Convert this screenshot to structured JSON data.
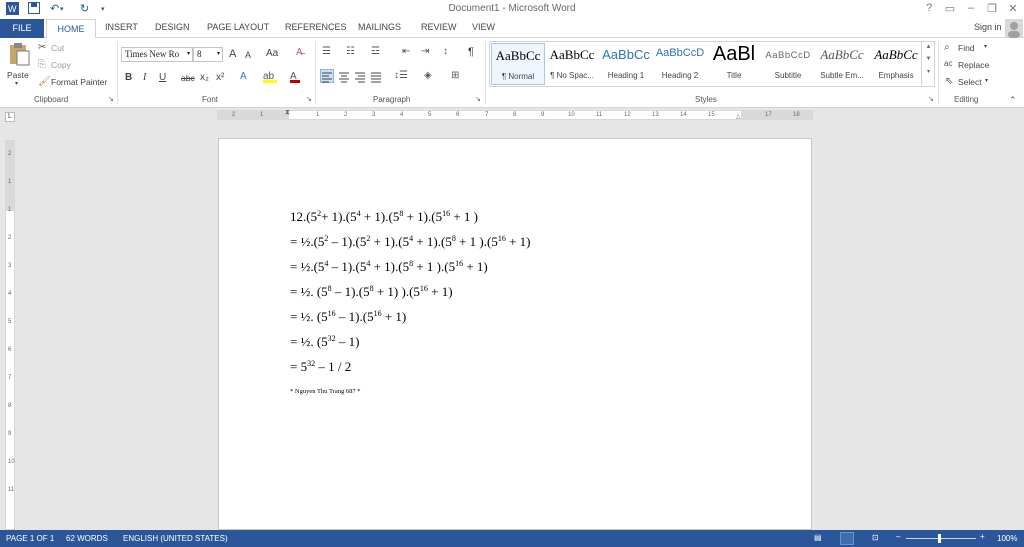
{
  "window": {
    "title": "Document1 - Microsoft Word"
  },
  "quick_access": {
    "word_icon": "word-icon",
    "save_icon": "save-icon",
    "undo_icon": "undo-icon",
    "redo_icon": "redo-icon"
  },
  "window_controls": {
    "help": "?",
    "restore_ribbon": "▭",
    "minimize": "–",
    "maximize": "❐",
    "close": "✕"
  },
  "tabs": [
    "FILE",
    "HOME",
    "INSERT",
    "DESIGN",
    "PAGE LAYOUT",
    "REFERENCES",
    "MAILINGS",
    "REVIEW",
    "VIEW"
  ],
  "sign_in": "Sign in",
  "clipboard": {
    "paste": "Paste",
    "cut": "Cut",
    "copy": "Copy",
    "format_painter": "Format Painter",
    "label": "Clipboard"
  },
  "font": {
    "name": "Times New Ro",
    "size": "8",
    "bold": "B",
    "italic": "I",
    "underline": "U",
    "strike": "abc",
    "sub": "x₂",
    "sup": "x²",
    "grow": "A",
    "shrink": "A",
    "case": "Aa",
    "label": "Font"
  },
  "paragraph": {
    "label": "Paragraph",
    "pilcrow": "¶"
  },
  "styles": {
    "label": "Styles",
    "items": [
      {
        "preview": "AaBbCc",
        "name": "¶ Normal"
      },
      {
        "preview": "AaBbCc",
        "name": "¶ No Spac..."
      },
      {
        "preview": "AaBbCc",
        "name": "Heading 1"
      },
      {
        "preview": "AaBbCcD",
        "name": "Heading 2"
      },
      {
        "preview": "AaBl",
        "name": "Title"
      },
      {
        "preview": "AaBbCcD",
        "name": "Subtitle"
      },
      {
        "preview": "AaBbCc",
        "name": "Subtle Em..."
      },
      {
        "preview": "AaBbCc",
        "name": "Emphasis"
      }
    ]
  },
  "editing": {
    "find": "Find",
    "replace": "Replace",
    "select": "Select",
    "label": "Editing"
  },
  "ruler": {
    "h_ticks": [
      "2",
      "1",
      "1",
      "2",
      "3",
      "4",
      "5",
      "6",
      "7",
      "8",
      "9",
      "10",
      "11",
      "12",
      "13",
      "14",
      "15",
      "17",
      "18"
    ],
    "v_ticks": [
      "2",
      "1",
      "1",
      "2",
      "3",
      "4",
      "5",
      "6",
      "7",
      "8",
      "9",
      "10",
      "11"
    ]
  },
  "document": {
    "lines": [
      {
        "parts": [
          "12.(5",
          "2",
          "+ 1).(5",
          "4",
          " + 1).(5",
          "8",
          " + 1).(5",
          "16",
          " + 1 )"
        ]
      },
      {
        "parts": [
          "= ½.(5",
          "2",
          " – 1).(5",
          "2",
          " + 1).(5",
          "4",
          " + 1).(5",
          "8",
          " + 1 ).(5",
          "16",
          " + 1)"
        ]
      },
      {
        "parts": [
          "= ½.(5",
          "4",
          " – 1).(5",
          "4",
          " + 1).(5",
          "8",
          " + 1 ).(5",
          "16",
          " + 1)"
        ]
      },
      {
        "parts": [
          "= ½. (5",
          "8",
          " – 1).(5",
          "8",
          " + 1) ).(5",
          "16",
          " + 1)"
        ]
      },
      {
        "parts": [
          "= ½. (5",
          "16",
          " – 1).(5",
          "16",
          " + 1)"
        ]
      },
      {
        "parts": [
          "= ½. (5",
          "32",
          " – 1)"
        ]
      },
      {
        "parts": [
          "= 5",
          "32",
          " – 1 / 2"
        ]
      }
    ],
    "signature": "* Nguyen Thu Trang 687 *"
  },
  "status": {
    "page": "PAGE 1 OF 1",
    "words": "62 WORDS",
    "language": "ENGLISH (UNITED STATES)",
    "zoom": "100%"
  },
  "colors": {
    "accent": "#2b579a",
    "highlight": "#ffff00",
    "font_color": "#c00000"
  }
}
